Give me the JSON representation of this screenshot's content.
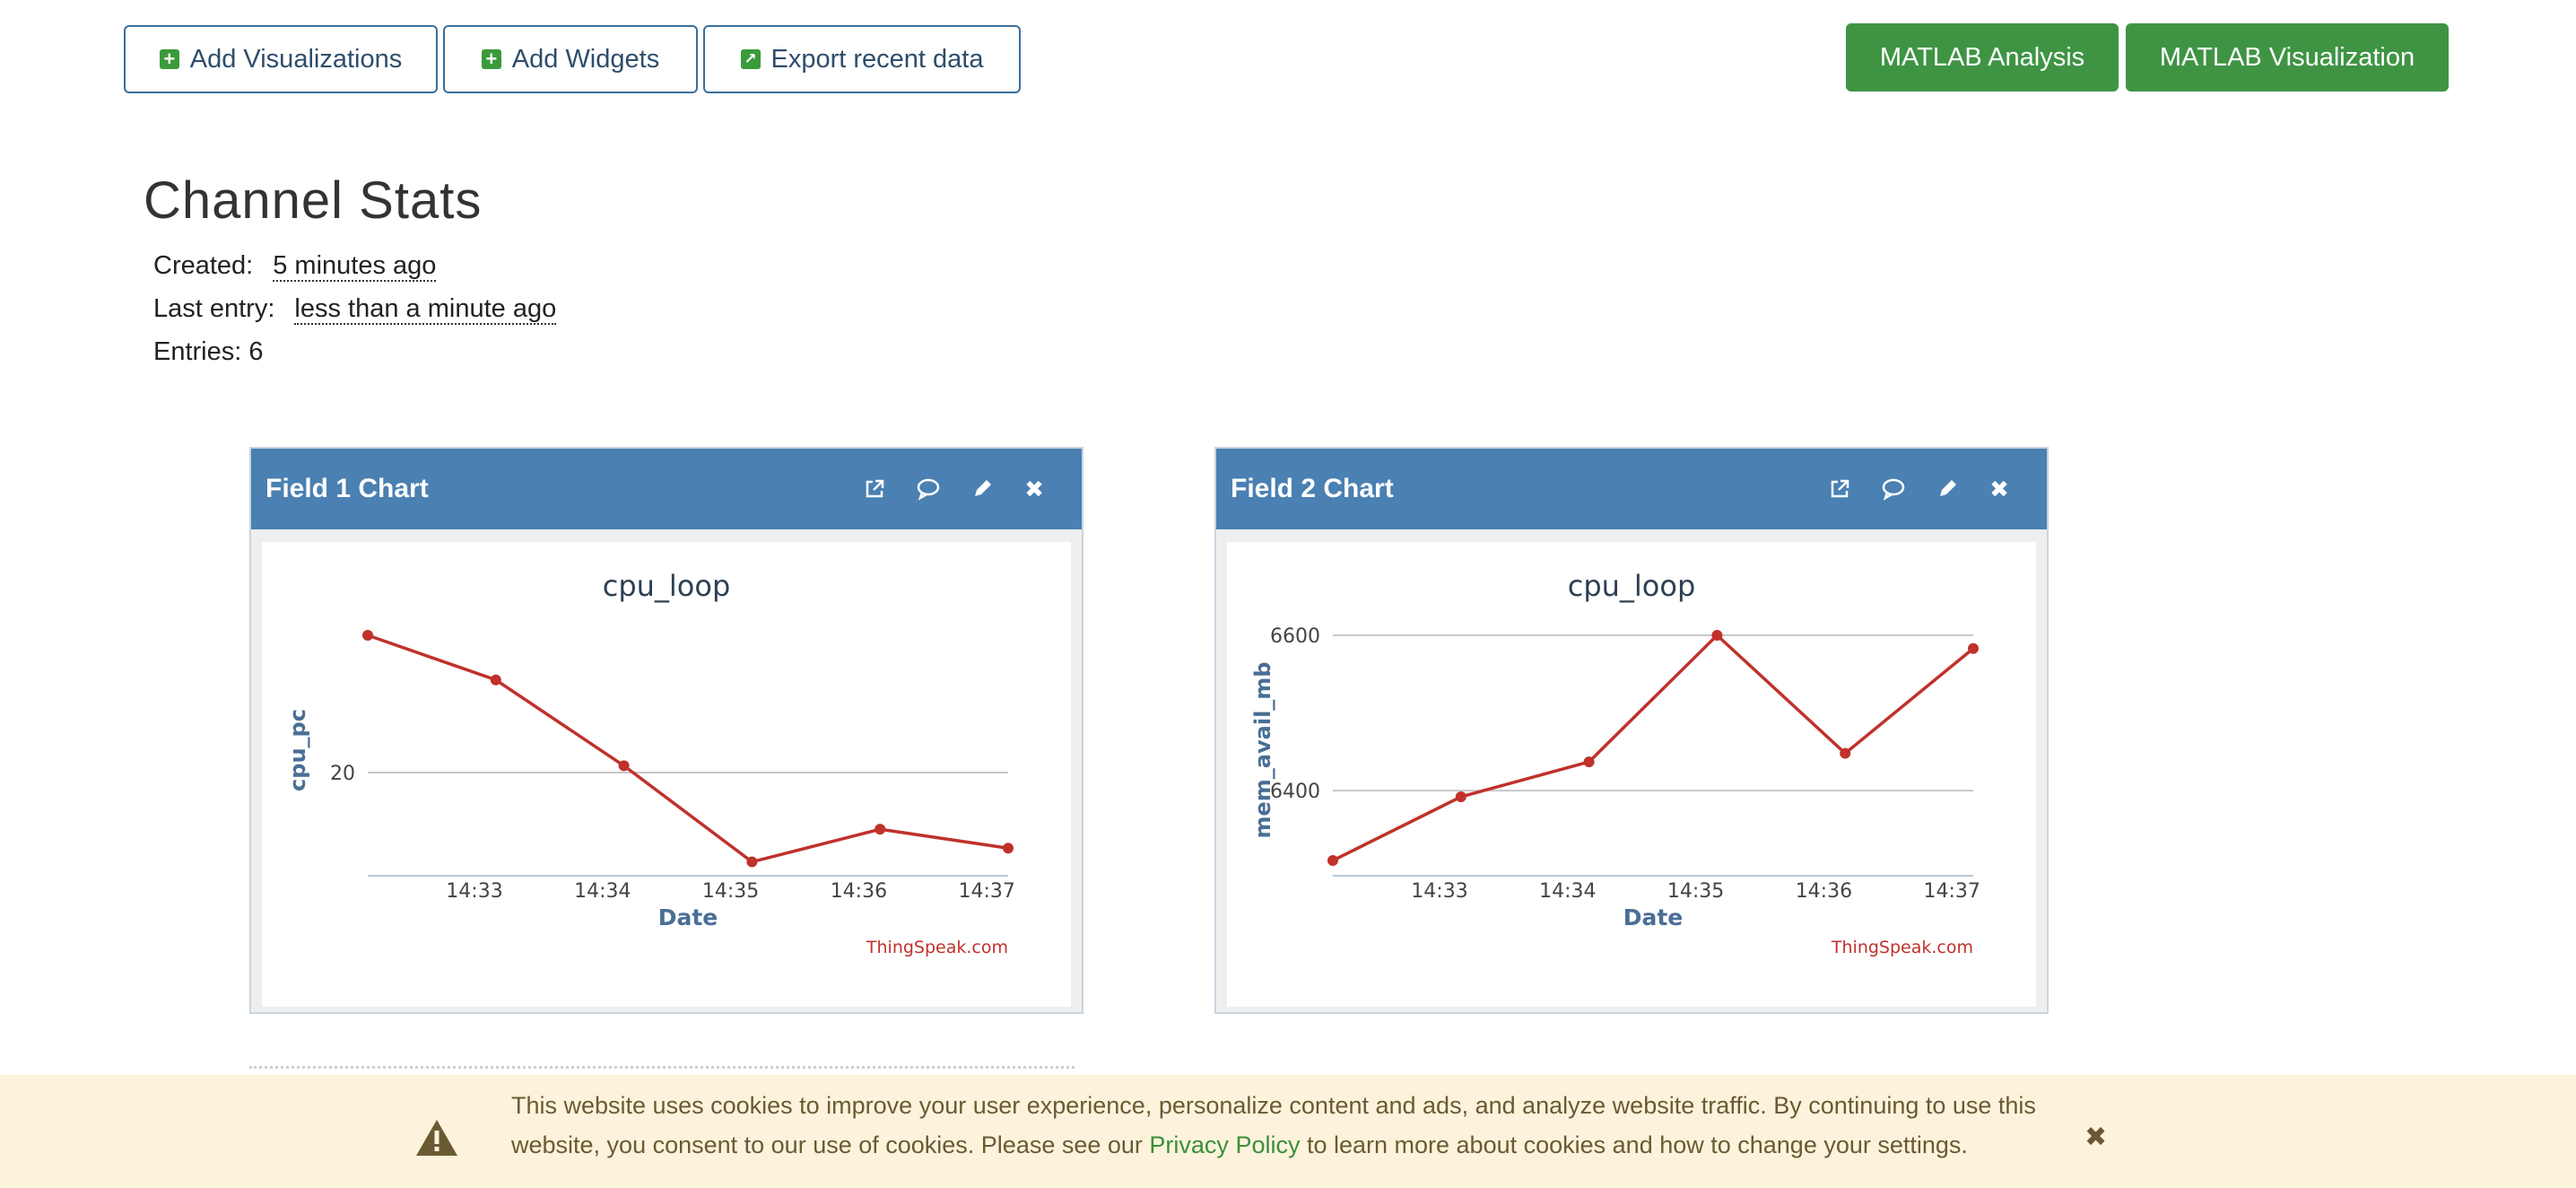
{
  "toolbar": {
    "add_visualizations": "Add Visualizations",
    "add_widgets": "Add Widgets",
    "export_recent": "Export recent data",
    "matlab_analysis": "MATLAB Analysis",
    "matlab_visualization": "MATLAB Visualization"
  },
  "stats": {
    "title": "Channel Stats",
    "created_label": "Created:",
    "created_value": "5 minutes ago",
    "last_entry_label": "Last entry:",
    "last_entry_value": "less than a minute ago",
    "entries": "Entries: 6"
  },
  "panels": [
    {
      "title": "Field 1 Chart"
    },
    {
      "title": "Field 2 Chart"
    }
  ],
  "chart_data": [
    {
      "type": "line",
      "title": "cpu_loop",
      "xlabel": "Date",
      "ylabel": "cpu_pc",
      "credit": "ThingSpeak.com",
      "x": [
        "14:32:10",
        "14:33:10",
        "14:34:10",
        "14:35:10",
        "14:36:10",
        "14:37:10"
      ],
      "values": [
        28.0,
        25.4,
        20.4,
        14.8,
        16.7,
        15.6
      ],
      "xlim": [
        "14:32:10",
        "14:37:10"
      ],
      "ylim": [
        14.2,
        28.0
      ],
      "xticks": [
        "14:33",
        "14:34",
        "14:35",
        "14:36",
        "14:37"
      ],
      "yticks": [
        20
      ],
      "color": "#c0312b"
    },
    {
      "type": "line",
      "title": "cpu_loop",
      "xlabel": "Date",
      "ylabel": "mem_avail_mb",
      "credit": "ThingSpeak.com",
      "x": [
        "14:32:10",
        "14:33:10",
        "14:34:10",
        "14:35:10",
        "14:36:10",
        "14:37:10"
      ],
      "values": [
        6310,
        6392,
        6437,
        6600,
        6448,
        6583
      ],
      "xlim": [
        "14:32:10",
        "14:37:10"
      ],
      "ylim": [
        6295,
        6600
      ],
      "xticks": [
        "14:33",
        "14:34",
        "14:35",
        "14:36",
        "14:37"
      ],
      "yticks": [
        6400,
        6600
      ],
      "color": "#c0312b"
    }
  ],
  "cookie": {
    "text_before": "This website uses cookies to improve your user experience, personalize content and ads, and analyze website traffic. By continuing to use this website, you consent to our use of cookies. Please see our ",
    "link": "Privacy Policy",
    "text_after": " to learn more about cookies and how to change your settings."
  }
}
